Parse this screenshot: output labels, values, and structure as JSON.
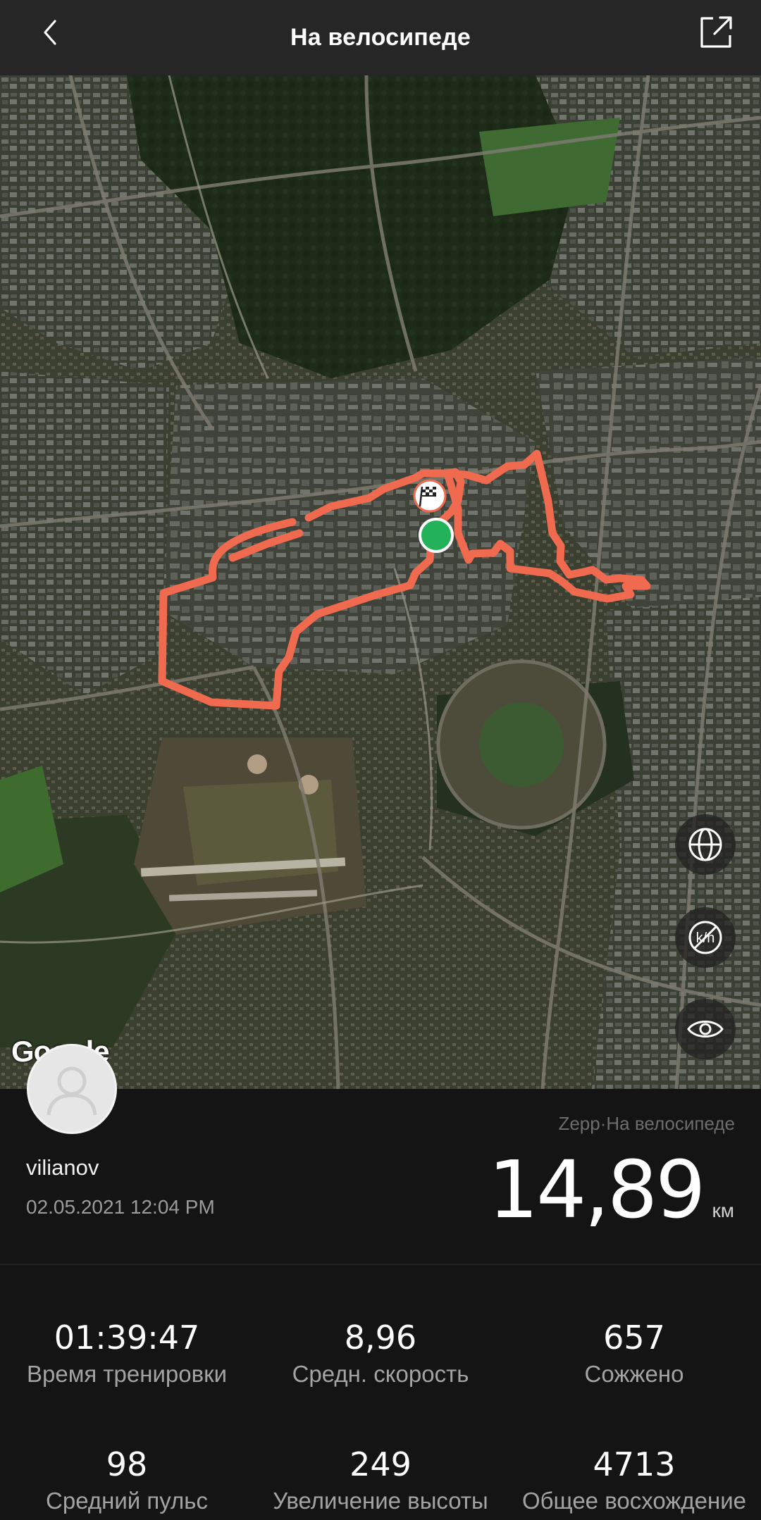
{
  "header": {
    "title": "На велосипеде",
    "back_icon": "chevron-left-icon",
    "share_icon": "share-external-icon"
  },
  "map": {
    "provider_logo": "Google",
    "route_color": "#ef6a4e",
    "start_marker_color": "#23b25a",
    "controls": [
      "globe-icon",
      "km-toggle-icon",
      "eye-icon"
    ]
  },
  "workout": {
    "username": "vilianov",
    "datetime": "02.05.2021 12:04 PM",
    "sport_label": "Zepp·На велосипеде",
    "distance_value": "14,89",
    "distance_unit": "км"
  },
  "stats": [
    {
      "value": "01:39:47",
      "label": "Время тренировки"
    },
    {
      "value": "8,96",
      "label": "Средн. скорость"
    },
    {
      "value": "657",
      "label": "Сожжено"
    },
    {
      "value": "98",
      "label": "Средний пульс"
    },
    {
      "value": "249",
      "label": "Увеличение высоты"
    },
    {
      "value": "4713",
      "label": "Общее восхождение"
    }
  ]
}
